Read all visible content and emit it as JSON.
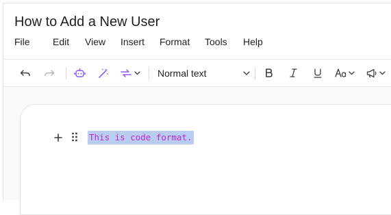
{
  "document": {
    "title": "How to Add a New User"
  },
  "menu": {
    "items": [
      "File",
      "Edit",
      "View",
      "Insert",
      "Format",
      "Tools",
      "Help"
    ]
  },
  "toolbar": {
    "text_style": "Normal text",
    "icons": [
      "undo-icon",
      "redo-icon",
      "ai-assistant-icon",
      "magic-wand-icon",
      "link-icon",
      "chevron-down-icon",
      "bold-icon",
      "italic-icon",
      "underline-icon",
      "text-size-icon",
      "announce-icon"
    ],
    "accent_color": "#8b5cf6"
  },
  "editor": {
    "code_text": "This is code format.",
    "code_color": "#c026d3",
    "selection_color": "#b9cdf0"
  }
}
